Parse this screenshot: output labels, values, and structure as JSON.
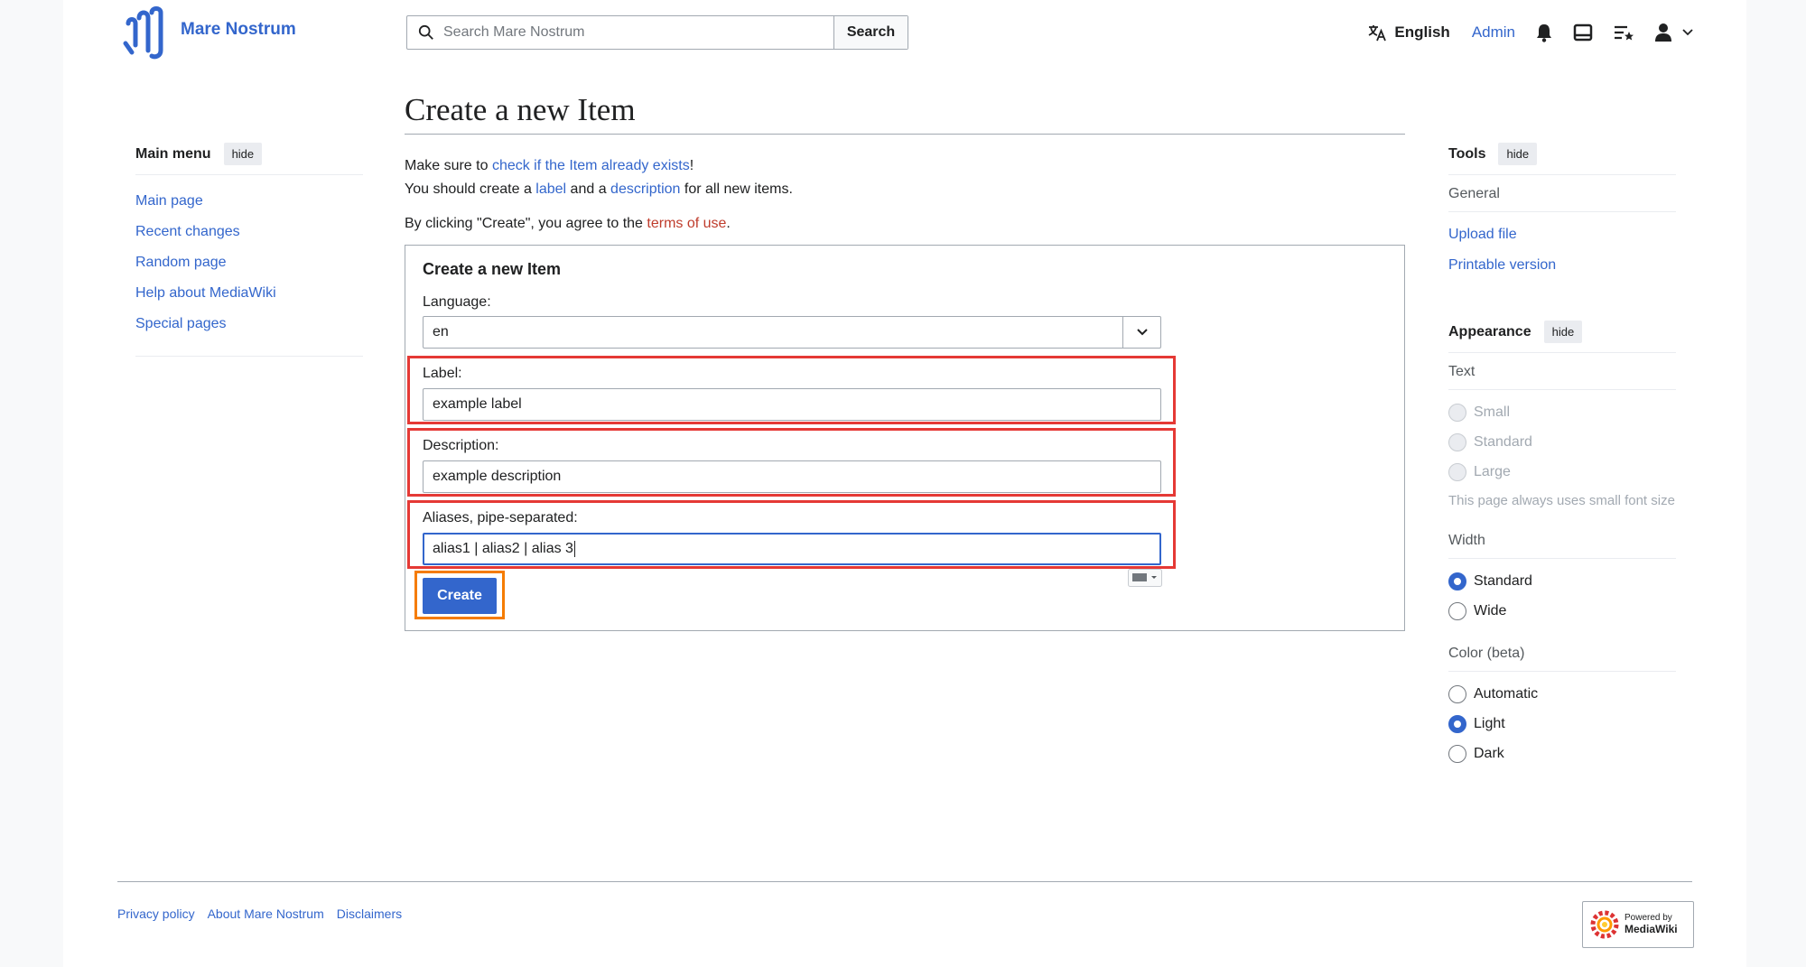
{
  "header": {
    "site_name": "Mare Nostrum",
    "search_placeholder": "Search Mare Nostrum",
    "search_button": "Search",
    "language": "English",
    "user": "Admin",
    "icons": [
      "translate-icon",
      "bell-icon",
      "inbox-icon",
      "watchlist-icon",
      "user-icon",
      "chevron-down-icon"
    ]
  },
  "left_menu": {
    "title": "Main menu",
    "hide": "hide",
    "items": [
      "Main page",
      "Recent changes",
      "Random page",
      "Help about MediaWiki",
      "Special pages"
    ]
  },
  "main": {
    "title": "Create a new Item",
    "line1_pre": "Make sure to ",
    "line1_link": "check if the Item already exists",
    "line1_post": "!",
    "line2_pre": "You should create a ",
    "line2_link1": "label",
    "line2_mid": " and a ",
    "line2_link2": "description",
    "line2_post": " for all new items.",
    "agree_pre": "By clicking \"Create\", you agree to the ",
    "agree_link": "terms of use",
    "agree_post": "."
  },
  "form": {
    "legend": "Create a new Item",
    "language_label": "Language:",
    "language_value": "en",
    "label_label": "Label:",
    "label_value": "example label",
    "description_label": "Description:",
    "description_value": "example description",
    "aliases_label": "Aliases, pipe-separated:",
    "aliases_value": "alias1 | alias2 | alias 3",
    "create_button": "Create"
  },
  "right_menu": {
    "tools_title": "Tools",
    "hide": "hide",
    "general": "General",
    "tools": [
      "Upload file",
      "Printable version"
    ],
    "appearance_title": "Appearance",
    "text_head": "Text",
    "text_options": [
      "Small",
      "Standard",
      "Large"
    ],
    "text_note": "This page always uses small font size",
    "width_head": "Width",
    "width_options": [
      "Standard",
      "Wide"
    ],
    "width_selected": "Standard",
    "color_head": "Color (beta)",
    "color_options": [
      "Automatic",
      "Light",
      "Dark"
    ],
    "color_selected": "Light"
  },
  "footer": {
    "links": [
      "Privacy policy",
      "About Mare Nostrum",
      "Disclaimers"
    ],
    "powered_line1": "Powered by",
    "powered_line2": "MediaWiki"
  },
  "colors": {
    "link": "#3366cc",
    "highlight_red": "#e53935",
    "highlight_orange": "#f57c00",
    "red_link": "#bf3c2c"
  }
}
